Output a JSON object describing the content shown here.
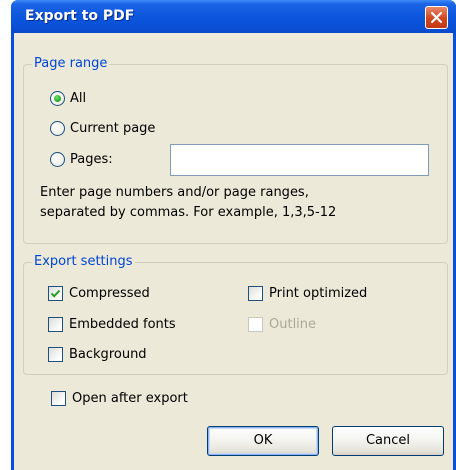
{
  "window": {
    "title": "Export to PDF"
  },
  "page_range": {
    "legend": "Page range",
    "options": [
      {
        "label": "All",
        "selected": true
      },
      {
        "label": "Current page",
        "selected": false
      },
      {
        "label": "Pages:",
        "selected": false
      }
    ],
    "pages_input_value": "",
    "hint_line1": "Enter page numbers and/or page ranges,",
    "hint_line2": "separated by commas. For example, 1,3,5-12"
  },
  "export_settings": {
    "legend": "Export settings",
    "compressed": {
      "label": "Compressed",
      "checked": true
    },
    "print_optimized": {
      "label": "Print optimized",
      "checked": false
    },
    "embedded_fonts": {
      "label": "Embedded fonts",
      "checked": false
    },
    "outline": {
      "label": "Outline",
      "checked": false,
      "enabled": false
    },
    "background": {
      "label": "Background",
      "checked": false
    }
  },
  "open_after_export": {
    "label": "Open after export",
    "checked": false
  },
  "buttons": {
    "ok": "OK",
    "cancel": "Cancel"
  },
  "colors": {
    "titlebar": "#0a54dc",
    "dialog_bg": "#ece9d8",
    "legend_text": "#0046d5",
    "close_button": "#d2451f",
    "check_mark": "#21a121"
  },
  "icons": {
    "close": "close-icon",
    "check": "checkmark-icon"
  }
}
